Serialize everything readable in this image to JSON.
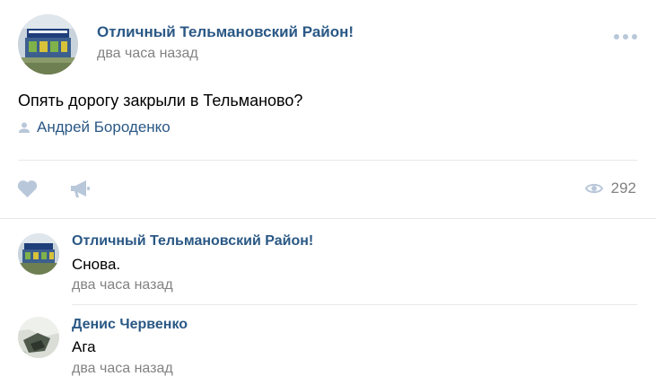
{
  "post": {
    "author": "Отличный Тельмановский Район!",
    "date": "два часа назад",
    "text": "Опять дорогу закрыли в Тельманово?",
    "signer": "Андрей Бороденко",
    "views": "292",
    "icons": {
      "more": "more-dots-icon",
      "signer": "user-icon",
      "like": "heart-icon",
      "share": "megaphone-icon",
      "views": "eye-icon"
    }
  },
  "comments": [
    {
      "author": "Отличный Тельмановский Район!",
      "text": "Снова.",
      "date": "два часа назад"
    },
    {
      "author": "Денис Червенко",
      "text": "Ага",
      "date": "два часа назад"
    }
  ],
  "colors": {
    "link": "#2a5885",
    "muted": "#828282",
    "icon": "#b8c7d9",
    "divider": "#e7e8ec"
  }
}
